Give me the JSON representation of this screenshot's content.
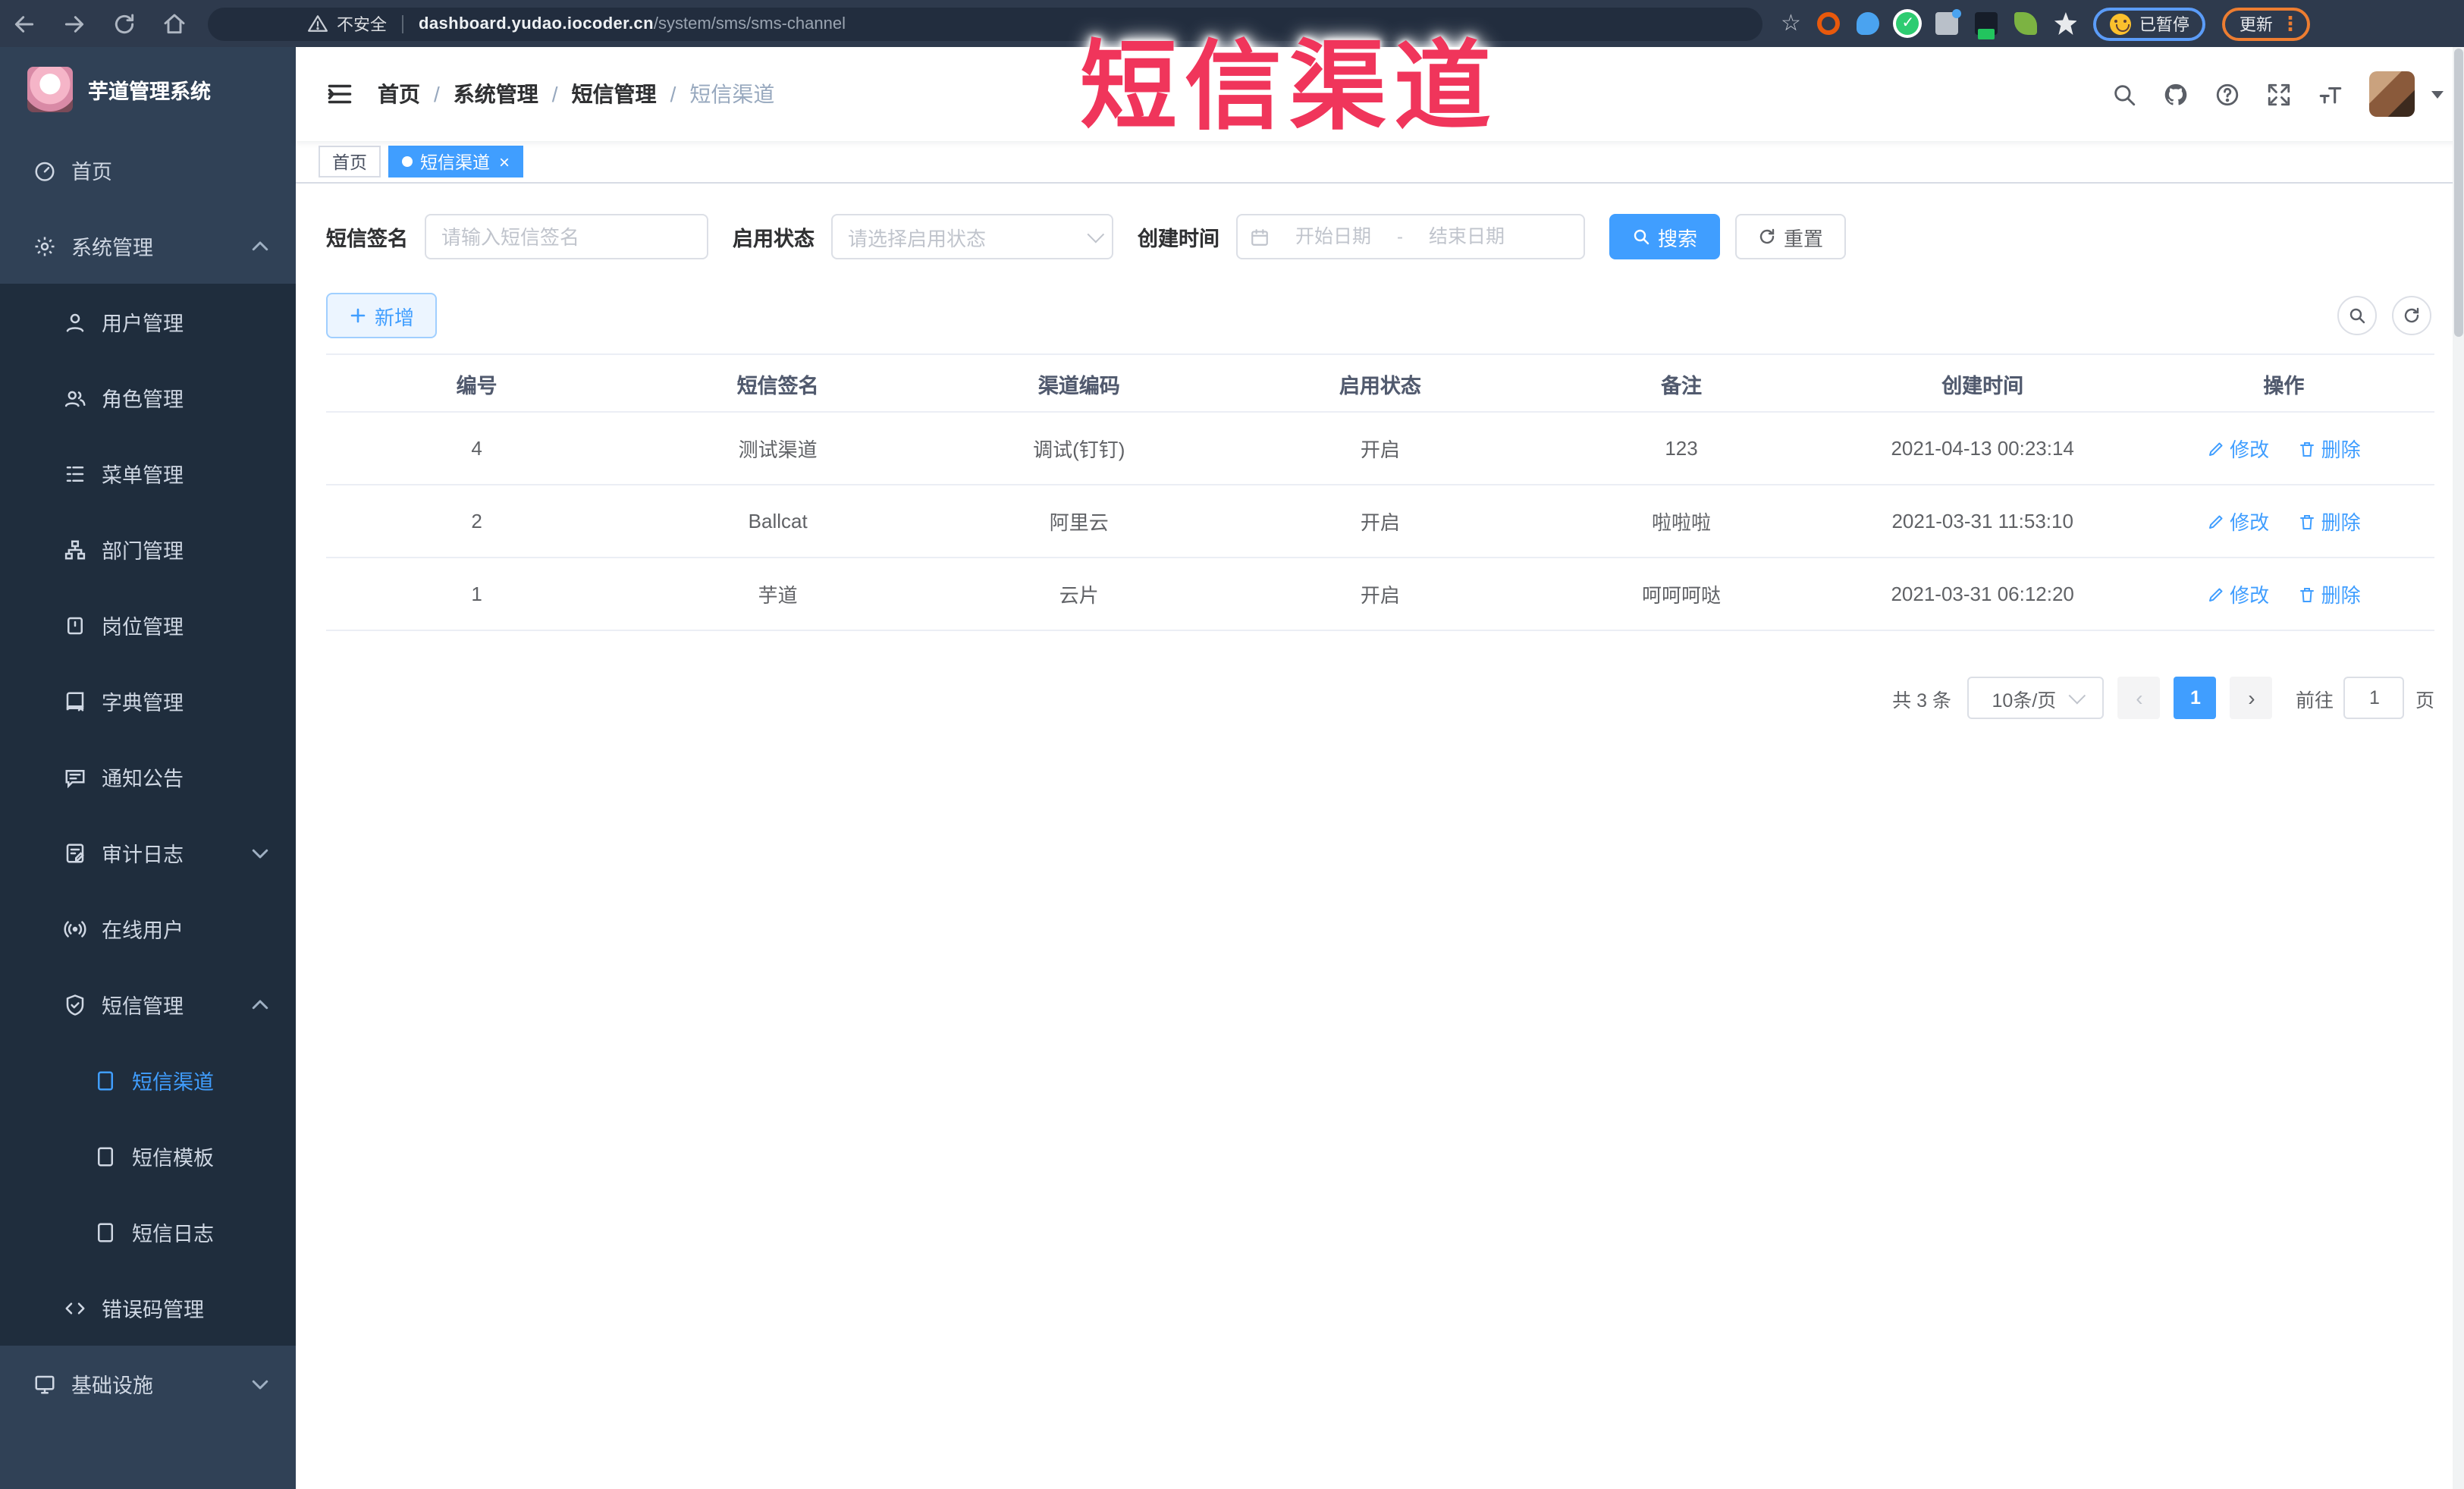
{
  "colors": {
    "accent": "#409eff",
    "sidebar_bg": "#304156",
    "submenu_bg": "#1f2d3d",
    "overlay_red": "#f0355b",
    "tag_active": "#409eff"
  },
  "icons": {
    "close": "×",
    "prev": "‹",
    "next": "›",
    "kebab": "⋮",
    "star": "☆"
  },
  "browser": {
    "security_label": "不安全",
    "url_host": "dashboard.yudao.iocoder.cn",
    "url_path": "/system/sms/sms-channel",
    "paused_badge": "已暂停",
    "update_button": "更新"
  },
  "overlay": {
    "title": "短信渠道"
  },
  "sidebar": {
    "app_title": "芋道管理系统",
    "menu": [
      {
        "label": "首页"
      },
      {
        "label": "系统管理"
      },
      {
        "label": "用户管理"
      },
      {
        "label": "角色管理"
      },
      {
        "label": "菜单管理"
      },
      {
        "label": "部门管理"
      },
      {
        "label": "岗位管理"
      },
      {
        "label": "字典管理"
      },
      {
        "label": "通知公告"
      },
      {
        "label": "审计日志"
      },
      {
        "label": "在线用户"
      },
      {
        "label": "短信管理"
      },
      {
        "label": "短信渠道"
      },
      {
        "label": "短信模板"
      },
      {
        "label": "短信日志"
      },
      {
        "label": "错误码管理"
      },
      {
        "label": "基础设施"
      }
    ]
  },
  "breadcrumb": {
    "items": [
      "首页",
      "系统管理",
      "短信管理",
      "短信渠道"
    ],
    "separator": "/"
  },
  "tags": {
    "home": "首页",
    "current": "短信渠道"
  },
  "search": {
    "sign_label": "短信签名",
    "sign_placeholder": "请输入短信签名",
    "status_label": "启用状态",
    "status_placeholder": "请选择启用状态",
    "time_label": "创建时间",
    "start_placeholder": "开始日期",
    "range_sep": "-",
    "end_placeholder": "结束日期",
    "search_btn": "搜索",
    "reset_btn": "重置",
    "add_btn": "新增"
  },
  "table": {
    "headers": [
      "编号",
      "短信签名",
      "渠道编码",
      "启用状态",
      "备注",
      "创建时间",
      "操作"
    ],
    "edit_label": "修改",
    "delete_label": "删除",
    "rows": [
      {
        "id": "4",
        "sign": "测试渠道",
        "code": "调试(钉钉)",
        "status": "开启",
        "remark": "123",
        "created": "2021-04-13 00:23:14"
      },
      {
        "id": "2",
        "sign": "Ballcat",
        "code": "阿里云",
        "status": "开启",
        "remark": "啦啦啦",
        "created": "2021-03-31 11:53:10"
      },
      {
        "id": "1",
        "sign": "芋道",
        "code": "云片",
        "status": "开启",
        "remark": "呵呵呵哒",
        "created": "2021-03-31 06:12:20"
      }
    ]
  },
  "pagination": {
    "total": "共 3 条",
    "page_size": "10条/页",
    "current": "1",
    "goto_label": "前往",
    "goto_value": "1",
    "page_unit": "页"
  }
}
